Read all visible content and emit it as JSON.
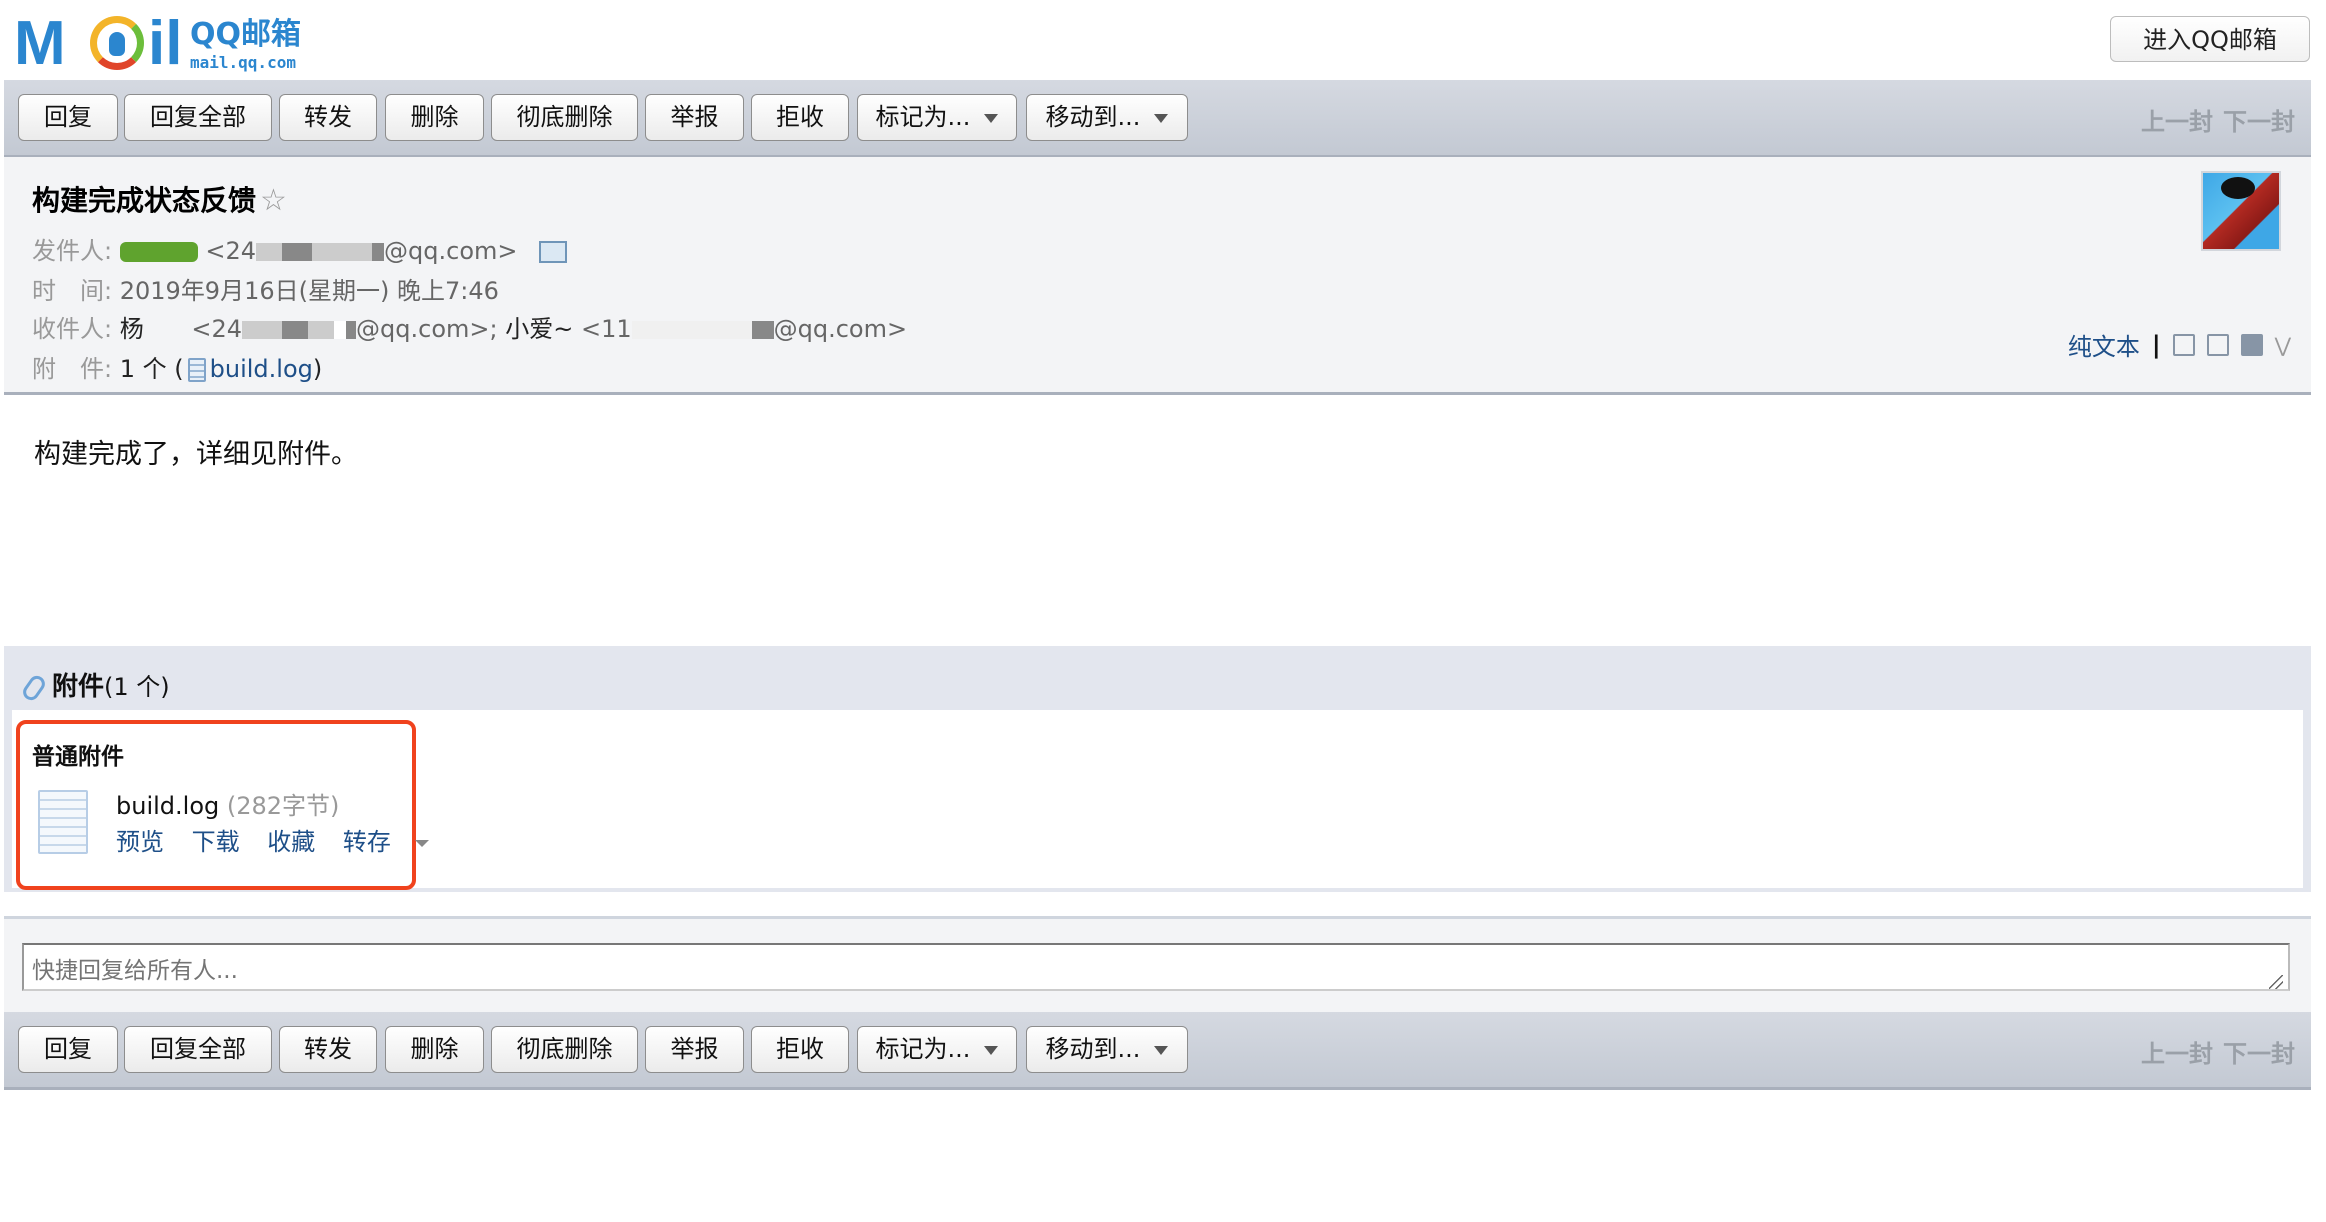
{
  "app": {
    "logo_text": "QQ邮箱",
    "logo_domain": "mail.qq.com",
    "enter_button": "进入QQ邮箱"
  },
  "toolbar": {
    "buttons": [
      "回复",
      "回复全部",
      "转发",
      "删除",
      "彻底删除",
      "举报",
      "拒收",
      "标记为...",
      "移动到..."
    ],
    "prev": "上一封",
    "next": "下一封"
  },
  "mail": {
    "subject": "构建完成状态反馈",
    "star": "☆",
    "from_label": "发件人:",
    "from_email_prefix": "<24",
    "from_email_suffix": "@qq.com>",
    "time_label": "时　间:",
    "time_value": "2019年9月16日(星期一) 晚上7:46",
    "to_label": "收件人:",
    "to_1_name": "杨",
    "to_1_email_prefix": "<24",
    "to_1_email_suffix": "@qq.com>;",
    "to_2_name": "小爱~",
    "to_2_email_prefix": "<11",
    "to_2_email_suffix": "@qq.com>",
    "attach_label": "附　件:",
    "attach_count": "1 个 (",
    "attach_link": "build.log",
    "attach_close": ")",
    "plain_text": "纯文本",
    "separator": "|",
    "body": "构建完成了，详细见附件。"
  },
  "attachments": {
    "title": "附件",
    "count": "(1 个)",
    "type_label": "普通附件",
    "file_name": "build.log",
    "file_size": "(282字节)",
    "actions": [
      "预览",
      "下载",
      "收藏",
      "转存"
    ],
    "highlight_color": "#f0421d"
  },
  "quick_reply": {
    "placeholder": "快捷回复给所有人..."
  }
}
